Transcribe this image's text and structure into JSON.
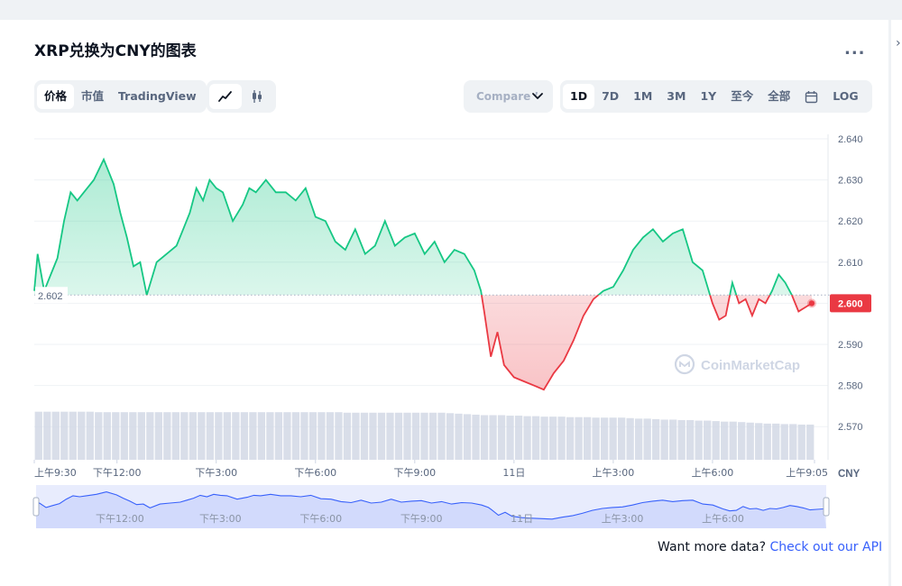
{
  "title": "XRP兑换为CNY的图表",
  "more_label": "...",
  "tabs": [
    {
      "label": "价格",
      "active": true
    },
    {
      "label": "市值",
      "active": false
    },
    {
      "label": "TradingView",
      "active": false
    }
  ],
  "chart_type_buttons": [
    {
      "icon": "line-chart-icon",
      "active": true
    },
    {
      "icon": "candlestick-icon",
      "active": false
    }
  ],
  "compare_label": "Compare ’",
  "ranges": [
    {
      "label": "1D",
      "active": true
    },
    {
      "label": "7D",
      "active": false
    },
    {
      "label": "1M",
      "active": false
    },
    {
      "label": "3M",
      "active": false
    },
    {
      "label": "1Y",
      "active": false
    },
    {
      "label": "至今",
      "active": false
    },
    {
      "label": "全部",
      "active": false
    },
    {
      "label": "",
      "icon": "calendar-icon",
      "active": false
    },
    {
      "label": "LOG",
      "active": false
    }
  ],
  "watermark": "CoinMarketCap",
  "footer": {
    "text": "Want more data? ",
    "link": "Check out our API"
  },
  "colors": {
    "up": "#16c784",
    "down": "#ea3943",
    "baseline": "#a6b0c3",
    "navigator_line": "#3861fb",
    "volume": "#cfd6e4"
  },
  "chart_data": {
    "type": "area",
    "currency": "CNY",
    "baseline": 2.602,
    "baseline_label": "2.602",
    "current_price_label": "2.600",
    "ylim": [
      2.562,
      2.643
    ],
    "yticks": [
      "2.640",
      "2.630",
      "2.620",
      "2.610",
      "2.600",
      "2.590",
      "2.580",
      "2.570"
    ],
    "xlim": [
      9.5,
      33.083
    ],
    "xticks": [
      {
        "label": "上午9:30",
        "x": 9.5
      },
      {
        "label": "下午12:00",
        "x": 12.0
      },
      {
        "label": "下午3:00",
        "x": 15.0
      },
      {
        "label": "下午6:00",
        "x": 18.0
      },
      {
        "label": "下午9:00",
        "x": 21.0
      },
      {
        "label": "11日",
        "x": 24.0
      },
      {
        "label": "上午3:00",
        "x": 27.0
      },
      {
        "label": "上午6:00",
        "x": 30.0
      },
      {
        "label": "上午9:05",
        "x": 33.083
      }
    ],
    "navigator_ticks": [
      {
        "label": "下午12:00",
        "x": 12.0
      },
      {
        "label": "下午3:00",
        "x": 15.0
      },
      {
        "label": "下午6:00",
        "x": 18.0
      },
      {
        "label": "下午9:00",
        "x": 21.0
      },
      {
        "label": "11日",
        "x": 24.0
      },
      {
        "label": "上午3:00",
        "x": 27.0
      },
      {
        "label": "上午6:00",
        "x": 30.0
      }
    ],
    "series": [
      {
        "x": [
          9.5,
          9.6,
          9.8,
          10.0,
          10.2,
          10.4,
          10.6,
          10.8,
          11.0,
          11.3,
          11.6,
          11.9,
          12.1,
          12.3,
          12.5,
          12.7,
          12.9,
          13.2,
          13.5,
          13.8,
          14.0,
          14.2,
          14.4,
          14.6,
          14.8,
          15.0,
          15.2,
          15.5,
          15.8,
          16.0,
          16.2,
          16.5,
          16.8,
          17.1,
          17.4,
          17.7,
          18.0,
          18.3,
          18.6,
          18.9,
          19.2,
          19.5,
          19.8,
          20.1,
          20.4,
          20.7,
          21.0,
          21.3,
          21.6,
          21.9,
          22.2,
          22.5,
          22.8,
          23.0,
          23.1,
          23.3,
          23.5,
          23.7,
          24.0,
          24.3,
          24.6,
          24.9,
          25.2,
          25.5,
          25.8,
          26.1,
          26.4,
          26.7,
          27.0,
          27.3,
          27.6,
          27.9,
          28.2,
          28.5,
          28.8,
          29.1,
          29.4,
          29.7,
          30.0,
          30.2,
          30.4,
          30.6,
          30.8,
          31.0,
          31.2,
          31.4,
          31.6,
          31.8,
          32.0,
          32.2,
          32.4,
          32.6,
          32.8,
          33.0
        ],
        "y": [
          2.603,
          2.612,
          2.603,
          2.607,
          2.611,
          2.62,
          2.627,
          2.625,
          2.627,
          2.63,
          2.635,
          2.629,
          2.622,
          2.616,
          2.609,
          2.61,
          2.602,
          2.61,
          2.612,
          2.614,
          2.618,
          2.622,
          2.628,
          2.625,
          2.63,
          2.628,
          2.627,
          2.62,
          2.624,
          2.628,
          2.627,
          2.63,
          2.627,
          2.627,
          2.625,
          2.628,
          2.621,
          2.62,
          2.615,
          2.613,
          2.618,
          2.612,
          2.614,
          2.62,
          2.614,
          2.616,
          2.617,
          2.612,
          2.615,
          2.61,
          2.613,
          2.612,
          2.608,
          2.603,
          2.598,
          2.587,
          2.593,
          2.585,
          2.582,
          2.581,
          2.58,
          2.579,
          2.583,
          2.586,
          2.591,
          2.597,
          2.601,
          2.603,
          2.604,
          2.608,
          2.613,
          2.616,
          2.618,
          2.615,
          2.617,
          2.618,
          2.61,
          2.608,
          2.6,
          2.596,
          2.597,
          2.605,
          2.6,
          2.601,
          2.597,
          2.601,
          2.6,
          2.603,
          2.607,
          2.605,
          2.602,
          2.598,
          2.599,
          2.6
        ]
      }
    ],
    "volume": [
      0.97,
      0.97,
      0.97,
      0.97,
      0.97,
      0.97,
      0.97,
      0.96,
      0.96,
      0.96,
      0.96,
      0.96,
      0.96,
      0.96,
      0.96,
      0.96,
      0.96,
      0.96,
      0.96,
      0.96,
      0.96,
      0.96,
      0.96,
      0.96,
      0.96,
      0.96,
      0.96,
      0.96,
      0.96,
      0.96,
      0.96,
      0.96,
      0.96,
      0.96,
      0.96,
      0.96,
      0.95,
      0.95,
      0.95,
      0.95,
      0.95,
      0.95,
      0.95,
      0.95,
      0.95,
      0.95,
      0.95,
      0.95,
      0.94,
      0.93,
      0.92,
      0.91,
      0.9,
      0.9,
      0.9,
      0.89,
      0.89,
      0.88,
      0.88,
      0.87,
      0.87,
      0.87,
      0.86,
      0.86,
      0.86,
      0.85,
      0.85,
      0.85,
      0.85,
      0.84,
      0.83,
      0.83,
      0.82,
      0.81,
      0.81,
      0.8,
      0.8,
      0.79,
      0.79,
      0.78,
      0.77,
      0.77,
      0.76,
      0.75,
      0.74,
      0.73,
      0.73,
      0.72,
      0.72,
      0.71,
      0.71
    ]
  }
}
